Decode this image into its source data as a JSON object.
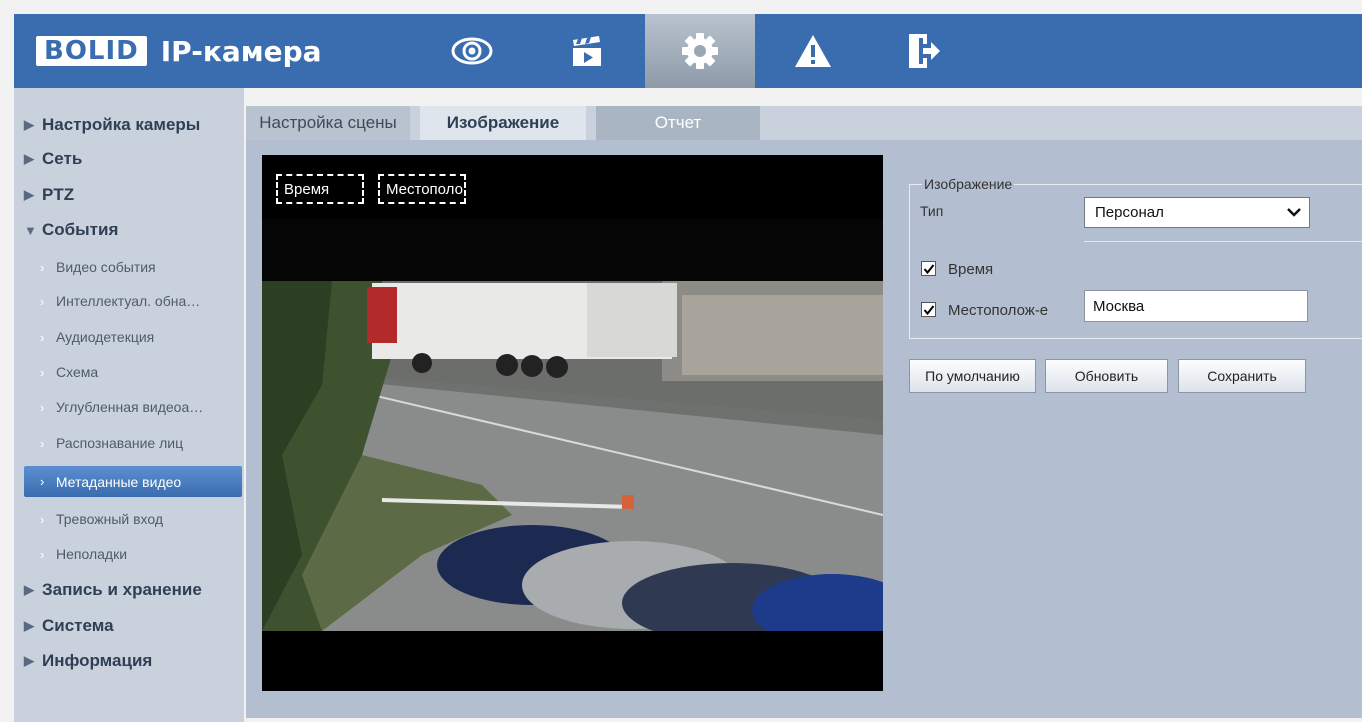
{
  "header": {
    "logo_brand": "BOLID",
    "logo_text": "IP-камера",
    "nav": [
      {
        "icon": "eye-icon"
      },
      {
        "icon": "clapperboard-icon"
      },
      {
        "icon": "gear-icon",
        "active": true
      },
      {
        "icon": "warning-icon"
      },
      {
        "icon": "logout-icon"
      }
    ]
  },
  "sidebar": {
    "items": [
      {
        "label": "Настройка камеры",
        "level": 1,
        "arrow": "▶"
      },
      {
        "label": "Сеть",
        "level": 1,
        "arrow": "▶"
      },
      {
        "label": "PTZ",
        "level": 1,
        "arrow": "▶"
      },
      {
        "label": "События",
        "level": 1,
        "arrow": "▼"
      },
      {
        "label": "Видео события",
        "level": 2
      },
      {
        "label": "Интеллектуал. обна…",
        "level": 2
      },
      {
        "label": "Аудиодетекция",
        "level": 2
      },
      {
        "label": "Схема",
        "level": 2
      },
      {
        "label": "Углубленная видеоа…",
        "level": 2
      },
      {
        "label": "Распознавание лиц",
        "level": 2
      },
      {
        "label": "Метаданные видео",
        "level": 2,
        "active": true
      },
      {
        "label": "Тревожный вход",
        "level": 2
      },
      {
        "label": "Неполадки",
        "level": 2
      },
      {
        "label": "Запись и хранение",
        "level": 1,
        "arrow": "▶"
      },
      {
        "label": "Система",
        "level": 1,
        "arrow": "▶"
      },
      {
        "label": "Информация",
        "level": 1,
        "arrow": "▶"
      }
    ]
  },
  "tabs": [
    {
      "label": "Настройка сцены"
    },
    {
      "label": "Изображение",
      "active": true
    },
    {
      "label": "Отчет"
    }
  ],
  "video": {
    "osd_time": "Время",
    "osd_location": "Местополо"
  },
  "panel": {
    "group_title": "Изображение",
    "type_label": "Тип",
    "type_value": "Персонал",
    "time_label": "Время",
    "time_checked": true,
    "location_label": "Местополож-е",
    "location_checked": true,
    "location_value": "Москва"
  },
  "buttons": {
    "default": "По умолчанию",
    "refresh": "Обновить",
    "save": "Сохранить"
  },
  "colors": {
    "header_bg": "#3a6db0",
    "sidebar_bg": "#c9d2dc",
    "content_bg": "#b3bfd0",
    "active_item": "#3a6db0"
  }
}
